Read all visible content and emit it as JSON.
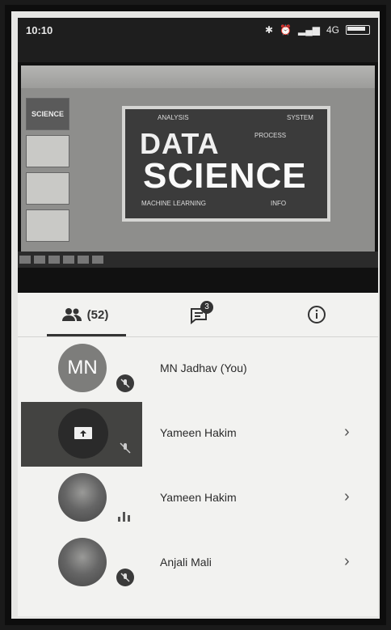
{
  "status": {
    "time": "10:10",
    "network": "4G"
  },
  "slide": {
    "line1": "DATA",
    "line2": "SCIENCE",
    "labels": [
      "ANALYSIS",
      "SYSTEM",
      "PROCESS",
      "MACHINE LEARNING",
      "INFO"
    ],
    "thumb_label": "SCIENCE"
  },
  "tabs": {
    "people_count": "(52)",
    "chat_badge": "3"
  },
  "participants": [
    {
      "initials": "MN",
      "name": "MN Jadhav (You)"
    },
    {
      "name": "Yameen Hakim"
    },
    {
      "name": "Yameen Hakim"
    },
    {
      "name": "Anjali Mali"
    }
  ],
  "colors": {
    "accent": "#333333",
    "background": "#f2f2f0",
    "presenting_bg": "#434341"
  }
}
